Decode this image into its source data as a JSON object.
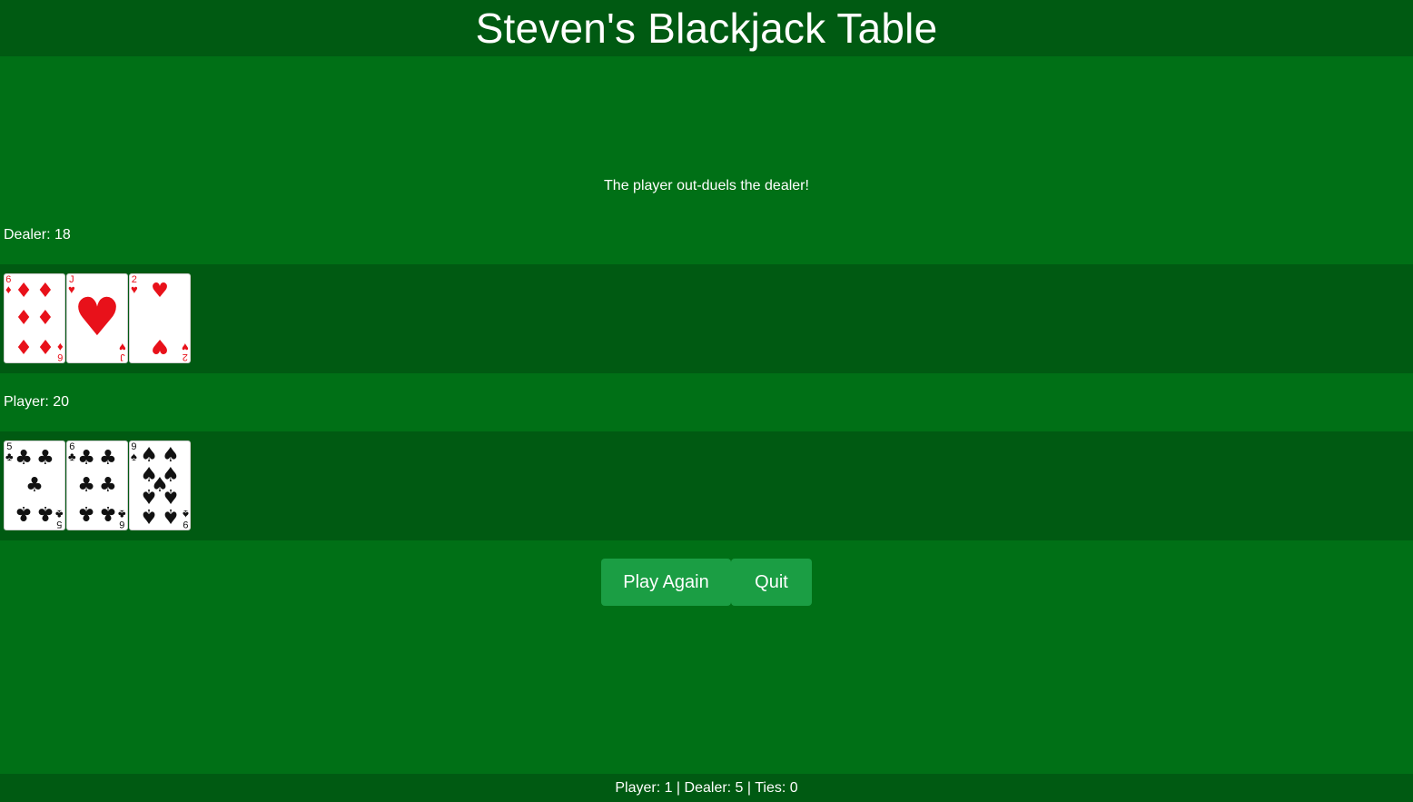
{
  "header": {
    "title": "Steven's Blackjack Table"
  },
  "message": "The player out-duels the dealer!",
  "dealer": {
    "label": "Dealer: 18",
    "cards": [
      {
        "rank": "6",
        "suit": "diamonds",
        "suit_symbol": "♦",
        "color": "red"
      },
      {
        "rank": "J",
        "suit": "hearts",
        "suit_symbol": "♥",
        "color": "red"
      },
      {
        "rank": "2",
        "suit": "hearts",
        "suit_symbol": "♥",
        "color": "red"
      }
    ]
  },
  "player": {
    "label": "Player: 20",
    "cards": [
      {
        "rank": "5",
        "suit": "clubs",
        "suit_symbol": "♣",
        "color": "black"
      },
      {
        "rank": "6",
        "suit": "clubs",
        "suit_symbol": "♣",
        "color": "black"
      },
      {
        "rank": "9",
        "suit": "spades",
        "suit_symbol": "♠",
        "color": "black"
      }
    ]
  },
  "buttons": {
    "play_again": "Play Again",
    "quit": "Quit"
  },
  "footer": {
    "tally": "Player: 1 | Dealer: 5 | Ties: 0"
  },
  "colors": {
    "felt": "#007016",
    "felt_dark": "#005a12",
    "button": "#1b9e44",
    "red_suit": "#e8111a",
    "black_suit": "#111111"
  }
}
